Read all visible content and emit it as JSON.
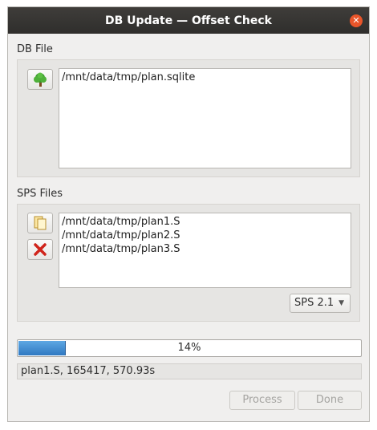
{
  "window": {
    "title": "DB Update — Offset Check"
  },
  "db_section": {
    "label": "DB File",
    "open_icon": "tree-icon",
    "path": "/mnt/data/tmp/plan.sqlite"
  },
  "sps_section": {
    "label": "SPS Files",
    "add_icon": "open-files-icon",
    "remove_icon": "red-x-icon",
    "files": [
      "/mnt/data/tmp/plan1.S",
      "/mnt/data/tmp/plan2.S",
      "/mnt/data/tmp/plan3.S"
    ],
    "format_selected": "SPS 2.1"
  },
  "progress": {
    "percent": 14,
    "label": "14%"
  },
  "status": {
    "text": "plan1.S, 165417, 570.93s"
  },
  "buttons": {
    "process": "Process",
    "done": "Done"
  },
  "colors": {
    "titlebar": "#2f2e2c",
    "close": "#e9552a",
    "progress_fill": "#3a86cf",
    "remove": "#d0241b"
  }
}
